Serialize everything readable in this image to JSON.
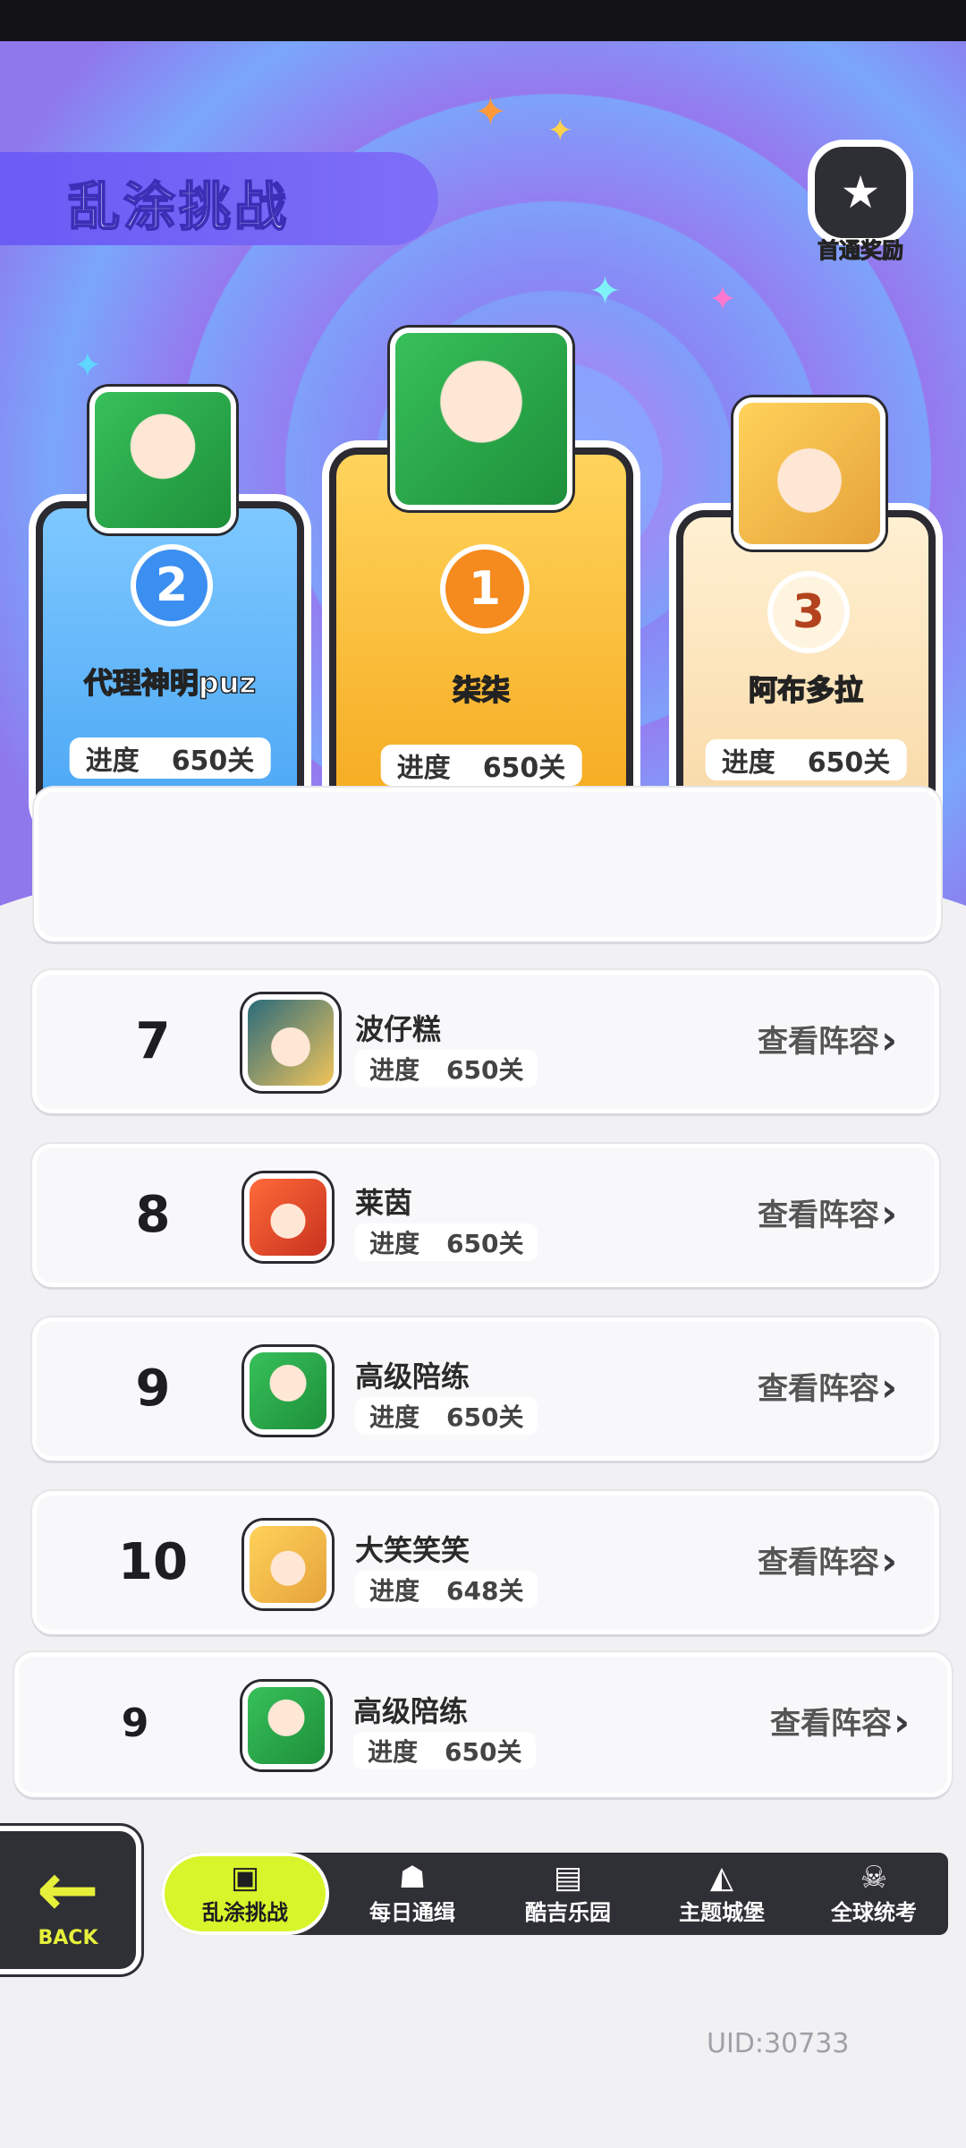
{
  "header": {
    "title": "乱涂挑战",
    "reward_label": "首通奖励"
  },
  "podium": [
    {
      "rank": "2",
      "name": "代理神明puz",
      "progress_label": "进度",
      "progress_value": "650关"
    },
    {
      "rank": "1",
      "name": "柒柒",
      "progress_label": "进度",
      "progress_value": "650关"
    },
    {
      "rank": "3",
      "name": "阿布多拉",
      "progress_label": "进度",
      "progress_value": "650关"
    }
  ],
  "list": [
    {
      "rank": "7",
      "name": "波仔糕",
      "progress_label": "进度",
      "progress_value": "650关",
      "action": "查看阵容"
    },
    {
      "rank": "8",
      "name": "莱茵",
      "progress_label": "进度",
      "progress_value": "650关",
      "action": "查看阵容"
    },
    {
      "rank": "9",
      "name": "高级陪练",
      "progress_label": "进度",
      "progress_value": "650关",
      "action": "查看阵容"
    },
    {
      "rank": "10",
      "name": "大笑笑笑",
      "progress_label": "进度",
      "progress_value": "648关",
      "action": "查看阵容"
    }
  ],
  "my_row": {
    "rank": "9",
    "name": "高级陪练",
    "progress_label": "进度",
    "progress_value": "650关",
    "action": "查看阵容"
  },
  "back_label": "BACK",
  "tabs": [
    {
      "label": "乱涂挑战",
      "icon": "gamepad-icon"
    },
    {
      "label": "每日通缉",
      "icon": "monster-icon"
    },
    {
      "label": "酷吉乐园",
      "icon": "console-icon"
    },
    {
      "label": "主题城堡",
      "icon": "castle-icon"
    },
    {
      "label": "全球统考",
      "icon": "skull-icon"
    }
  ],
  "uid": "UID:30733",
  "colors": {
    "accent": "#d7f52a",
    "title_bar": "#6a5cf5",
    "gold": "#f5a91e",
    "silver_blue": "#4aa6f4",
    "bronze": "#f8d9a6"
  }
}
